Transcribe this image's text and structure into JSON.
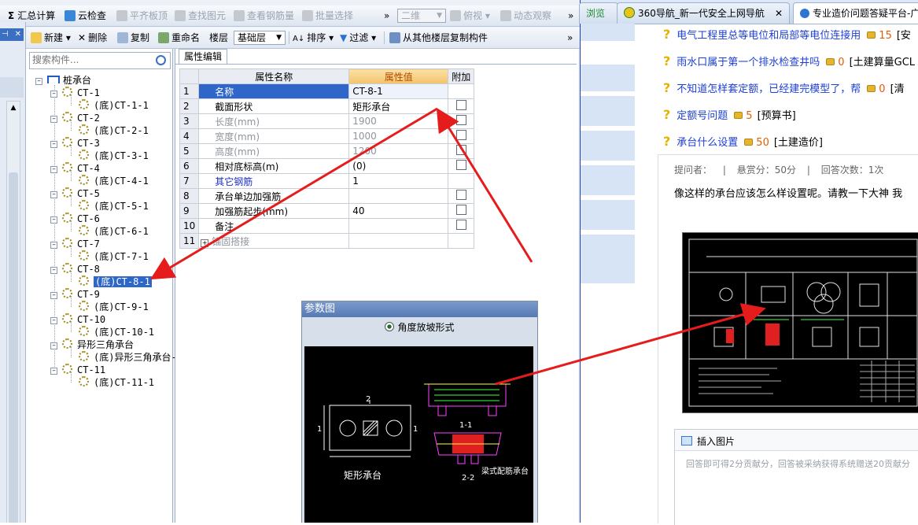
{
  "toolbar1": {
    "items": [
      "汇总计算",
      "云检查",
      "平齐板顶",
      "查找图元",
      "查看钢筋量",
      "批量选择",
      "二维",
      "俯视",
      "动态观察"
    ],
    "more": "»"
  },
  "toolbar2": {
    "new": "新建",
    "delete": "删除",
    "copy": "复制",
    "rename": "重命名",
    "floor_label": "楼层",
    "floor_value": "基础层",
    "sort": "排序",
    "filter": "过滤",
    "copy_from_floor": "从其他楼层复制构件",
    "more": "»"
  },
  "left_tab_close": "✕",
  "search": {
    "placeholder": "搜索构件..."
  },
  "tree": {
    "root": "桩承台",
    "items": [
      {
        "name": "CT-1",
        "child": "(底)CT-1-1"
      },
      {
        "name": "CT-2",
        "child": "(底)CT-2-1"
      },
      {
        "name": "CT-3",
        "child": "(底)CT-3-1"
      },
      {
        "name": "CT-4",
        "child": "(底)CT-4-1"
      },
      {
        "name": "CT-5",
        "child": "(底)CT-5-1"
      },
      {
        "name": "CT-6",
        "child": "(底)CT-6-1"
      },
      {
        "name": "CT-7",
        "child": "(底)CT-7-1"
      },
      {
        "name": "CT-8",
        "child": "(底)CT-8-1"
      },
      {
        "name": "CT-9",
        "child": "(底)CT-9-1"
      },
      {
        "name": "CT-10",
        "child": "(底)CT-10-1"
      },
      {
        "name": "异形三角承台",
        "child": "(底)异形三角承台-"
      },
      {
        "name": "CT-11",
        "child": "(底)CT-11-1"
      }
    ]
  },
  "property_tab": "属性编辑",
  "grid": {
    "headers": [
      "属性名称",
      "属性值",
      "附加"
    ],
    "rows": [
      {
        "n": "1",
        "name": "名称",
        "value": "CT-8-1"
      },
      {
        "n": "2",
        "name": "截面形状",
        "value": "矩形承台"
      },
      {
        "n": "3",
        "name": "长度(mm)",
        "value": "1900"
      },
      {
        "n": "4",
        "name": "宽度(mm)",
        "value": "1000"
      },
      {
        "n": "5",
        "name": "高度(mm)",
        "value": "1200"
      },
      {
        "n": "6",
        "name": "相对底标高(m)",
        "value": "(0)"
      },
      {
        "n": "7",
        "name": "其它钢筋",
        "value": "1"
      },
      {
        "n": "8",
        "name": "承台单边加强筋",
        "value": ""
      },
      {
        "n": "9",
        "name": "加强筋起步(mm)",
        "value": "40"
      },
      {
        "n": "10",
        "name": "备注",
        "value": ""
      },
      {
        "n": "11",
        "name": "锚固搭接",
        "value": ""
      }
    ]
  },
  "param_dialog": {
    "title": "参数图",
    "radio_label": "角度放坡形式",
    "labels": {
      "sec2": "2",
      "sec1a": "1",
      "sec1b": "1",
      "sec11": "1-1",
      "sec22": "2-2",
      "shape": "矩形承台",
      "beam": "梁式配筋承台"
    }
  },
  "browser": {
    "tabs": [
      "浏览",
      "360导航_新一代安全上网导航",
      "专业造价问题答疑平台-广"
    ],
    "questions": [
      {
        "title": "电气工程里总等电位和局部等电位连接用",
        "points": "15",
        "cat": "[安"
      },
      {
        "title": "雨水口属于第一个排水检查井吗",
        "points": "0",
        "cat": "[土建算量GCL"
      },
      {
        "title": "不知道怎样套定额，已经建完模型了，帮",
        "points": "0",
        "cat": "[清"
      },
      {
        "title": "定额号问题",
        "points": "5",
        "cat": "[预算书]"
      },
      {
        "title": "承台什么设置",
        "points": "50",
        "cat": "[土建造价]"
      }
    ],
    "meta": {
      "asker": "提问者：",
      "reward": "悬赏分：50分",
      "answers": "回答次数：1次",
      "sep": "|"
    },
    "body": "像这样的承台应该怎么样设置呢。请教一下大神 我",
    "insert_image": "插入图片",
    "answer_placeholder": "回答即可得2分贡献分，回答被采纳获得系统赠送20贡献分"
  }
}
